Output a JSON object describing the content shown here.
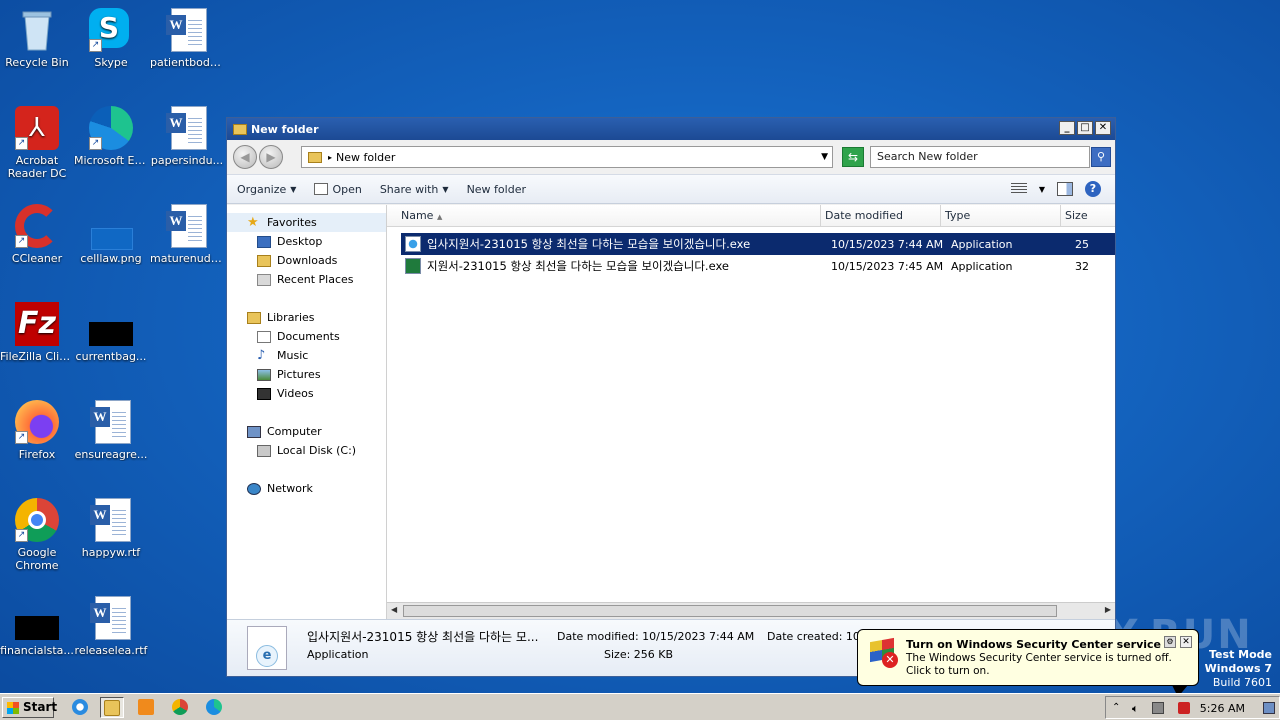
{
  "desktop": {
    "icons": [
      {
        "label": "Recycle Bin",
        "icon": "recycle-bin-icon"
      },
      {
        "label": "Skype",
        "icon": "skype-icon"
      },
      {
        "label": "patientbody...",
        "icon": "word-doc-icon"
      },
      {
        "label": "Acrobat Reader DC",
        "icon": "acrobat-icon"
      },
      {
        "label": "Microsoft Edge",
        "icon": "edge-icon"
      },
      {
        "label": "papersindu...",
        "icon": "word-doc-icon"
      },
      {
        "label": "CCleaner",
        "icon": "ccleaner-icon"
      },
      {
        "label": "celllaw.png",
        "icon": "image-icon"
      },
      {
        "label": "maturenude...",
        "icon": "word-doc-icon"
      },
      {
        "label": "FileZilla Client",
        "icon": "filezilla-icon"
      },
      {
        "label": "currentbag...",
        "icon": "black-file-icon"
      },
      {
        "label": "Firefox",
        "icon": "firefox-icon"
      },
      {
        "label": "ensureagre...",
        "icon": "word-doc-icon"
      },
      {
        "label": "Google Chrome",
        "icon": "chrome-icon"
      },
      {
        "label": "happyw.rtf",
        "icon": "word-doc-icon"
      },
      {
        "label": "financialsta...",
        "icon": "black-file-icon"
      },
      {
        "label": "releaselea.rtf",
        "icon": "word-doc-icon"
      }
    ]
  },
  "explorer": {
    "title": "New folder",
    "address": "New folder",
    "search_placeholder": "Search New folder",
    "toolbar": {
      "organize": "Organize",
      "open": "Open",
      "share_with": "Share with",
      "new_folder": "New folder"
    },
    "nav": {
      "favorites": "Favorites",
      "desktop": "Desktop",
      "downloads": "Downloads",
      "recent_places": "Recent Places",
      "libraries": "Libraries",
      "documents": "Documents",
      "music": "Music",
      "pictures": "Pictures",
      "videos": "Videos",
      "computer": "Computer",
      "local_disk": "Local Disk (C:)",
      "network": "Network"
    },
    "columns": {
      "name": "Name",
      "date_modified": "Date modified",
      "type": "Type",
      "size": "Size"
    },
    "files": [
      {
        "name": "입사지원서-231015 항상 최선을 다하는 모습을 보이겠습니다.exe",
        "date": "10/15/2023 7:44 AM",
        "type": "Application",
        "size": "25"
      },
      {
        "name": "지원서-231015 항상 최선을 다하는 모습을 보이겠습니다.exe",
        "date": "10/15/2023 7:45 AM",
        "type": "Application",
        "size": "32"
      }
    ],
    "details": {
      "name": "입사지원서-231015 항상 최선을 다하는 모...",
      "type": "Application",
      "date_modified": "Date modified: 10/15/2023 7:44 AM",
      "size": "Size: 256 KB",
      "date_created": "Date created: 10/"
    }
  },
  "balloon": {
    "title": "Turn on Windows Security Center service",
    "body": "The Windows Security Center service is turned off. Click to turn on."
  },
  "taskbar": {
    "start": "Start",
    "clock": "5:26 AM"
  },
  "watermark": {
    "line1": "Test Mode",
    "line2": "Windows 7",
    "line3": "Build 7601",
    "anyrun": "ANY.RUN"
  }
}
